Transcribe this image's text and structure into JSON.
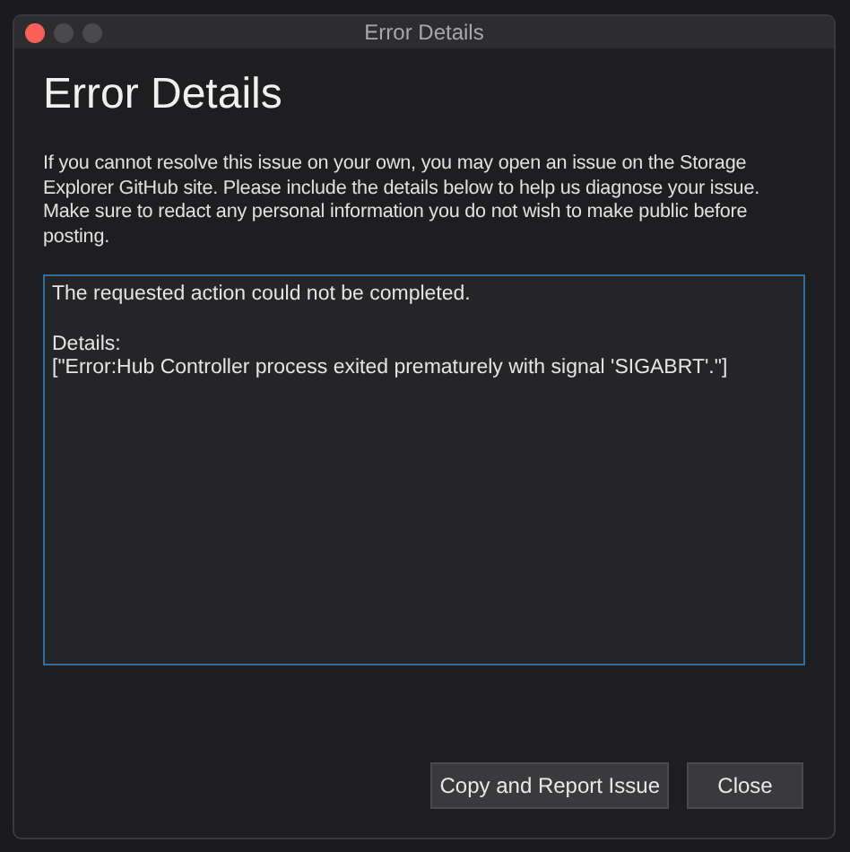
{
  "window": {
    "title": "Error Details"
  },
  "heading": "Error Details",
  "message": "If you cannot resolve this issue on your own, you may open an issue on the Storage Explorer GitHub site. Please include the details below to help us diagnose your issue. Make sure to redact any personal information you do not wish to make public before posting.",
  "details_field": {
    "value": "The requested action could not be completed.\n\nDetails:\n[\"Error:Hub Controller process exited prematurely with signal 'SIGABRT'.\"]"
  },
  "buttons": [
    "Copy and Report Issue",
    "Close"
  ]
}
